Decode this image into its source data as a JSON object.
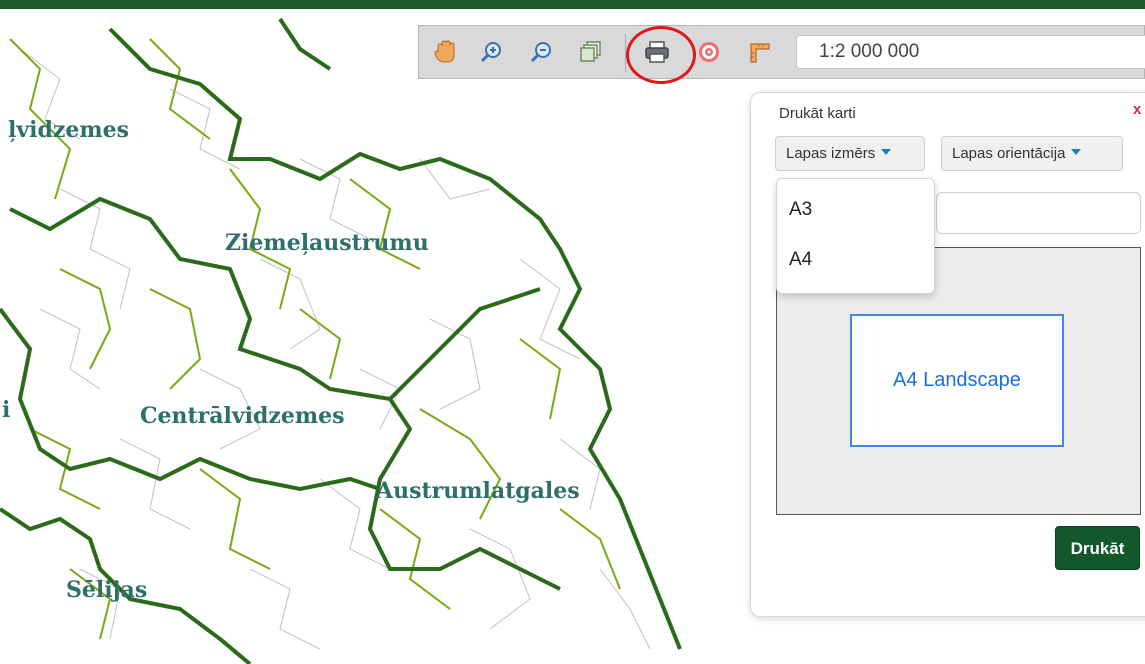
{
  "toolbar": {
    "icons": [
      "pan-hand-icon",
      "zoom-in-icon",
      "zoom-out-icon",
      "layers-icon",
      "printer-icon",
      "target-icon",
      "measure-icon"
    ],
    "scale_value": "1:2 000 000",
    "highlight_color": "#e01818"
  },
  "map": {
    "regions": [
      {
        "label": "ļvidzemes"
      },
      {
        "label": "Ziemeļaustrumu"
      },
      {
        "label": "Centrālvidzemes"
      },
      {
        "label": "Austrumlatgales"
      },
      {
        "label": "Sēlijas"
      },
      {
        "label": "i"
      }
    ],
    "colors": {
      "major_border": "#2a6a1a",
      "minor_border": "#79aa12",
      "municipal_border": "#b9b9b9",
      "label": "#2d6f6a"
    }
  },
  "print_panel": {
    "title": "Drukāt karti",
    "close_icon": "x",
    "page_size_label": "Lapas izmērs",
    "orientation_label": "Lapas orientācija",
    "size_options": [
      "A3",
      "A4"
    ],
    "preview_label": "A4 Landscape",
    "print_button": "Drukāt",
    "accent_color": "#12582a"
  }
}
